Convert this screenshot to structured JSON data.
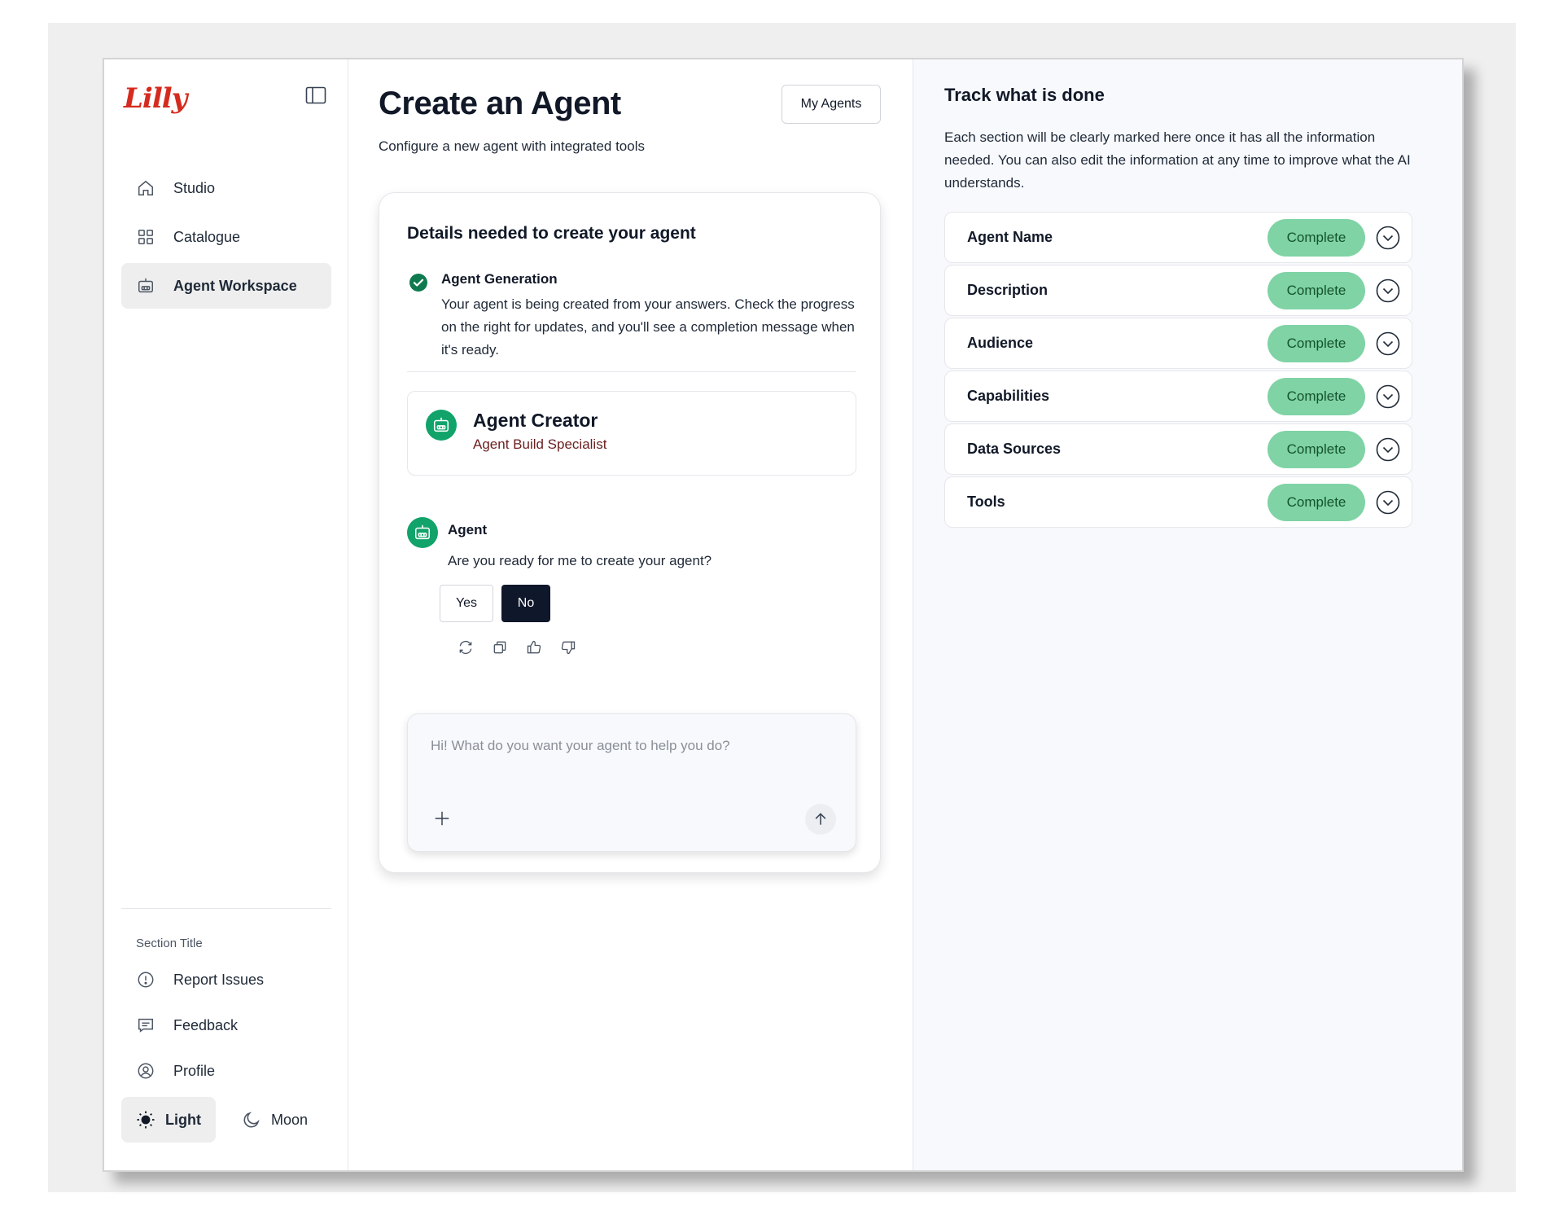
{
  "brand": {
    "logo_text": "Lilly",
    "logo_color": "#d52b1e"
  },
  "sidebar": {
    "items": [
      {
        "label": "Studio",
        "icon": "home-icon",
        "active": false
      },
      {
        "label": "Catalogue",
        "icon": "grid-icon",
        "active": false
      },
      {
        "label": "Agent Workspace",
        "icon": "robot-icon",
        "active": true
      }
    ],
    "section_title": "Section Title",
    "bottom_items": [
      {
        "label": "Report Issues",
        "icon": "alert-circle-icon"
      },
      {
        "label": "Feedback",
        "icon": "message-square-icon"
      },
      {
        "label": "Profile",
        "icon": "user-circle-icon"
      }
    ],
    "theme": {
      "light_label": "Light",
      "moon_label": "Moon",
      "selected": "Light"
    }
  },
  "main": {
    "title": "Create an Agent",
    "subtitle": "Configure a new agent with integrated tools",
    "my_agents_label": "My Agents",
    "card": {
      "title": "Details needed to create your agent",
      "generation": {
        "title": "Agent Generation",
        "text": "Your agent is being created from your answers. Check the progress on the right for updates, and you'll see a completion message when it's ready."
      },
      "creator": {
        "name": "Agent Creator",
        "role": "Agent Build Specialist"
      },
      "message": {
        "sender": "Agent",
        "text": "Are you ready for me to create your agent?",
        "yes_label": "Yes",
        "no_label": "No"
      },
      "composer": {
        "placeholder": "Hi! What do you want your agent to help you do?",
        "value": ""
      }
    }
  },
  "right_panel": {
    "title": "Track what is done",
    "description": "Each section will be clearly marked here once it has all the information needed. You can also edit the information at any time to improve what the AI understands.",
    "items": [
      {
        "label": "Agent Name",
        "status": "Complete"
      },
      {
        "label": "Description",
        "status": "Complete"
      },
      {
        "label": "Audience",
        "status": "Complete"
      },
      {
        "label": "Capabilities",
        "status": "Complete"
      },
      {
        "label": "Data Sources",
        "status": "Complete"
      },
      {
        "label": "Tools",
        "status": "Complete"
      }
    ],
    "status_color": "#7fd3a5"
  },
  "colors": {
    "accent_green": "#11a36a",
    "dark_button": "#0f172a",
    "brand_red": "#d52b1e"
  }
}
